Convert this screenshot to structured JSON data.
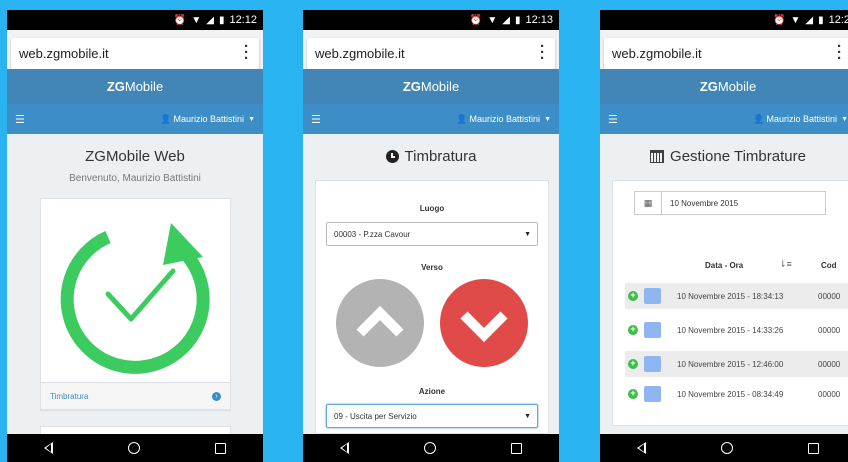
{
  "common": {
    "url": "web.zgmobile.it",
    "brand_bold": "ZG",
    "brand_rest": "Mobile",
    "menu_icon": "hamburger-icon",
    "user_name": "Maurizio Battistini"
  },
  "phones": [
    {
      "time": "12:12"
    },
    {
      "time": "12:13"
    },
    {
      "time": "12:2"
    }
  ],
  "home": {
    "title": "ZGMobile Web",
    "subtitle": "Benvenuto, Maurizio Battistini",
    "card_link": "Timbratura",
    "accent_green": "#3ccb5e"
  },
  "timbratura": {
    "title": "Timbratura",
    "luogo_label": "Luogo",
    "luogo_value": "00003 - P.zza Cavour",
    "verso_label": "Verso",
    "azione_label": "Azione",
    "azione_value": "09 - Uscita per Servizio",
    "up_color": "#b3b3b3",
    "down_color": "#e04b4a"
  },
  "gestione": {
    "title": "Gestione Timbrature",
    "date_value": "10 Novembre 2015",
    "col_date": "Data - Ora",
    "col_code": "Cod",
    "rows": [
      {
        "datetime": "10 Novembre 2015 - 18:34:13",
        "code": "00000"
      },
      {
        "datetime": "10 Novembre 2015 - 14:33:26",
        "code": "00000"
      },
      {
        "datetime": "10 Novembre 2015 - 12:46:00",
        "code": "00000"
      },
      {
        "datetime": "10 Novembre 2015 - 08:34:49",
        "code": "00000"
      }
    ]
  }
}
